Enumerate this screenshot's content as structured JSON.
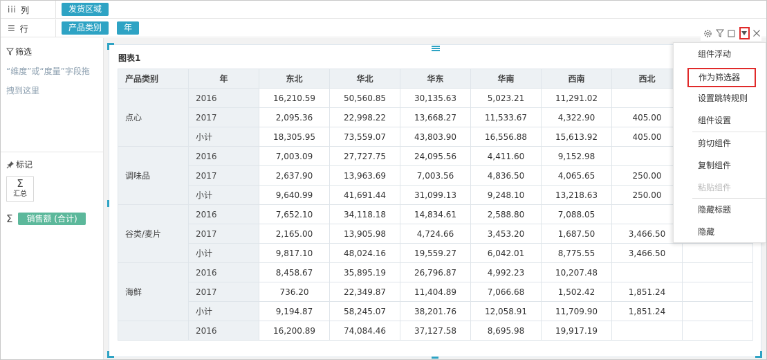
{
  "shelves": {
    "columns": {
      "label": "列",
      "pills": [
        "发货区域"
      ]
    },
    "rows": {
      "label": "行",
      "pills": [
        "产品类别",
        "年"
      ]
    }
  },
  "left_panel": {
    "filter": {
      "title": "筛选",
      "hint": "“维度”或“度量”字段拖拽到这里"
    },
    "marks": {
      "title": "标记",
      "agg_label": "汇总"
    },
    "measure": {
      "label": "销售额 (合计)"
    }
  },
  "chart": {
    "title": "图表1",
    "columns": [
      "产品类别",
      "年",
      "东北",
      "华北",
      "华东",
      "华南",
      "西南",
      "西北",
      ""
    ],
    "groups": [
      {
        "category": "点心",
        "rows": [
          {
            "year": "2016",
            "values": [
              "16,210.59",
              "50,560.85",
              "30,135.63",
              "5,023.21",
              "11,291.02",
              "",
              ""
            ]
          },
          {
            "year": "2017",
            "values": [
              "2,095.36",
              "22,998.22",
              "13,668.27",
              "11,533.67",
              "4,322.90",
              "405.00",
              ""
            ]
          },
          {
            "year": "小计",
            "values": [
              "18,305.95",
              "73,559.07",
              "43,803.90",
              "16,556.88",
              "15,613.92",
              "405.00",
              ""
            ]
          }
        ]
      },
      {
        "category": "调味品",
        "rows": [
          {
            "year": "2016",
            "values": [
              "7,003.09",
              "27,727.75",
              "24,095.56",
              "4,411.60",
              "9,152.98",
              "",
              ""
            ]
          },
          {
            "year": "2017",
            "values": [
              "2,637.90",
              "13,963.69",
              "7,003.56",
              "4,836.50",
              "4,065.65",
              "250.00",
              ""
            ]
          },
          {
            "year": "小计",
            "values": [
              "9,640.99",
              "41,691.44",
              "31,099.13",
              "9,248.10",
              "13,218.63",
              "250.00",
              ""
            ]
          }
        ]
      },
      {
        "category": "谷类/麦片",
        "rows": [
          {
            "year": "2016",
            "values": [
              "7,652.10",
              "34,118.18",
              "14,834.61",
              "2,588.80",
              "7,088.05",
              "",
              ""
            ]
          },
          {
            "year": "2017",
            "values": [
              "2,165.00",
              "13,905.98",
              "4,724.66",
              "3,453.20",
              "1,687.50",
              "3,466.50",
              ""
            ]
          },
          {
            "year": "小计",
            "values": [
              "9,817.10",
              "48,024.16",
              "19,559.27",
              "6,042.01",
              "8,775.55",
              "3,466.50",
              ""
            ]
          }
        ]
      },
      {
        "category": "海鲜",
        "rows": [
          {
            "year": "2016",
            "values": [
              "8,458.67",
              "35,895.19",
              "26,796.87",
              "4,992.23",
              "10,207.48",
              "",
              ""
            ]
          },
          {
            "year": "2017",
            "values": [
              "736.20",
              "22,349.87",
              "11,404.89",
              "7,066.68",
              "1,502.42",
              "1,851.24",
              ""
            ]
          },
          {
            "year": "小计",
            "values": [
              "9,194.87",
              "58,245.07",
              "38,201.76",
              "12,058.91",
              "11,709.90",
              "1,851.24",
              ""
            ]
          }
        ]
      },
      {
        "category": "",
        "rows": [
          {
            "year": "2016",
            "values": [
              "16,200.89",
              "74,084.46",
              "37,127.58",
              "8,695.98",
              "19,917.19",
              "",
              ""
            ]
          }
        ]
      }
    ]
  },
  "context_menu": {
    "items": [
      {
        "label": "组件浮动",
        "state": "normal"
      },
      {
        "label": "作为筛选器",
        "state": "highlighted"
      },
      {
        "label": "设置跳转规则",
        "state": "normal"
      },
      {
        "label": "组件设置",
        "state": "normal"
      },
      {
        "label": "剪切组件",
        "state": "normal"
      },
      {
        "label": "复制组件",
        "state": "normal"
      },
      {
        "label": "粘贴组件",
        "state": "disabled"
      },
      {
        "label": "隐藏标题",
        "state": "normal"
      },
      {
        "label": "隐藏",
        "state": "normal"
      }
    ]
  },
  "colors": {
    "accent": "#2ea3c4",
    "measure": "#5cb89b",
    "highlight": "#e02a2a"
  },
  "icons": [
    "columns-icon",
    "rows-icon",
    "filter-icon",
    "pin-icon",
    "sigma-icon",
    "gear-icon",
    "funnel-icon",
    "square-icon",
    "dropdown-icon",
    "close-icon"
  ]
}
